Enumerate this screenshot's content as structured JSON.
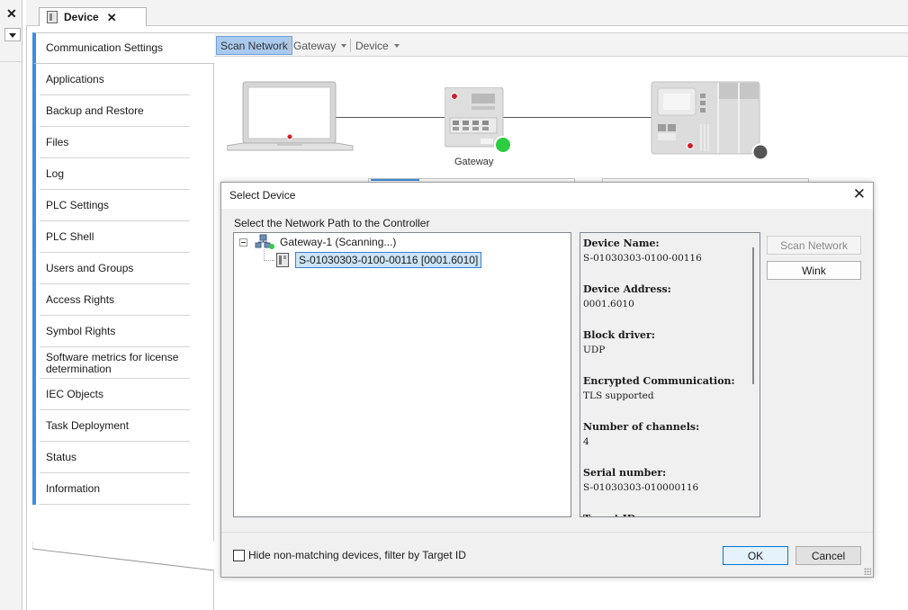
{
  "document_tab": {
    "title": "Device",
    "close_symbol": "✕"
  },
  "left_stub": {
    "close_symbol": "✕"
  },
  "nav": {
    "items": [
      "Communication Settings",
      "Applications",
      "Backup and Restore",
      "Files",
      "Log",
      "PLC Settings",
      "PLC Shell",
      "Users and Groups",
      "Access Rights",
      "Symbol Rights",
      "Software metrics for license determination",
      "IEC Objects",
      "Task Deployment",
      "Status",
      "Information"
    ],
    "active_index": 0,
    "accent_color": "#3c8dde"
  },
  "toolbar": {
    "scan_network": "Scan Network",
    "gateway": "Gateway",
    "device": "Device"
  },
  "topology": {
    "gateway_label": "Gateway",
    "gateway_status_color": "#2ecc40",
    "device_status_color": "#555555"
  },
  "dialog": {
    "title": "Select Device",
    "close_symbol": "✕",
    "caption": "Select the Network Path to the Controller",
    "tree": {
      "gateway_node": "Gateway-1 (Scanning...)",
      "device_node": "S-01030303-0100-00116 [0001.6010]"
    },
    "info": [
      {
        "label": "Device Name:",
        "value": "S-01030303-0100-00116"
      },
      {
        "label": "Device Address:",
        "value": "0001.6010"
      },
      {
        "label": "Block driver:",
        "value": "UDP"
      },
      {
        "label": "Encrypted Communication:",
        "value": "TLS supported"
      },
      {
        "label": "Number of channels:",
        "value": "4"
      },
      {
        "label": "Serial number:",
        "value": "S-01030303-010000116"
      },
      {
        "label": "Target ID:",
        "value": ""
      }
    ],
    "scan_network_button": "Scan Network",
    "wink_button": "Wink",
    "hide_checkbox_label": "Hide non-matching devices, filter by Target ID",
    "hide_checkbox_checked": false,
    "ok_button": "OK",
    "cancel_button": "Cancel"
  }
}
